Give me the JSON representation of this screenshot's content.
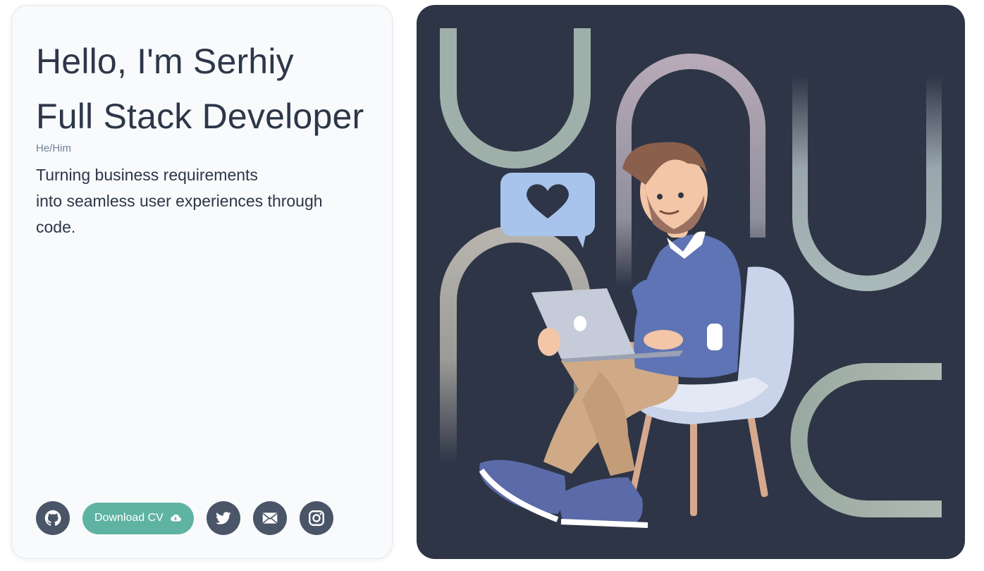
{
  "profile": {
    "greeting": "Hello, I'm Serhiy",
    "role": "Full Stack Developer",
    "pronouns": "He/Him",
    "tagline_lines": [
      "Turning business requirements",
      "into seamless user experiences through",
      "code."
    ]
  },
  "actions": {
    "github_icon": "github-icon",
    "download_cv_label": "Download CV",
    "download_cv_icon": "cloud-download-icon",
    "twitter_icon": "twitter-icon",
    "email_icon": "mail-icon",
    "instagram_icon": "instagram-icon"
  },
  "hero": {
    "illustration": "developer-with-laptop-illustration",
    "background_color": "#2e3546"
  },
  "colors": {
    "text": "#2d3748",
    "muted": "#718096",
    "icon_button": "#4a5568",
    "accent": "#5fb3a3",
    "card": "#f8fafc"
  }
}
